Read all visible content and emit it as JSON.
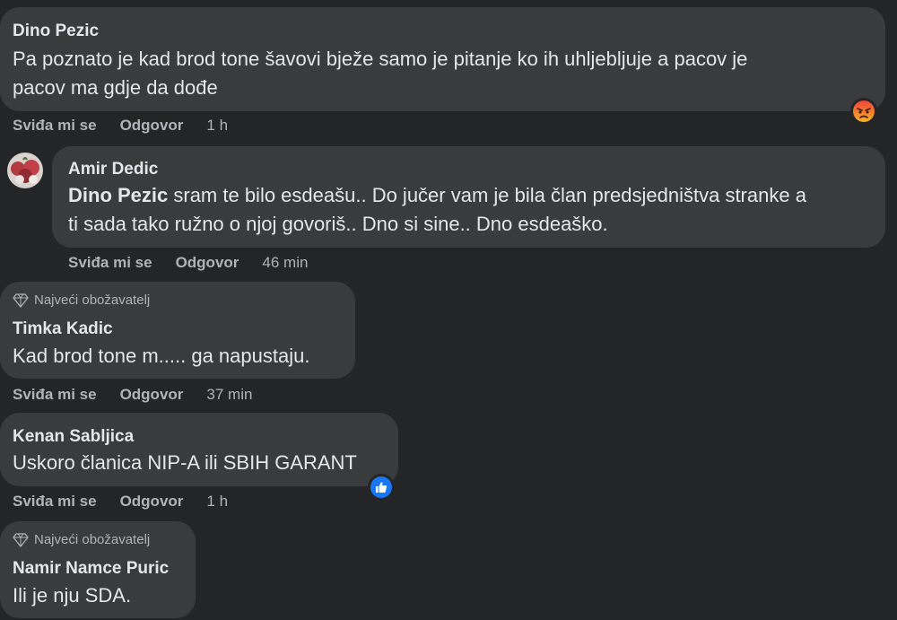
{
  "comments": [
    {
      "author": "Dino Pezic",
      "text_lines": [
        "Pa poznato je kad brod tone šavovi bježe samo je pitanje ko ih uhljebljuje a pacov je",
        "pacov ma gdje da dođe"
      ],
      "like_label": "Sviđa mi se",
      "reply_label": "Odgovor",
      "time": "1 h",
      "reaction": "angry-reaction-icon"
    },
    {
      "author": "Amir Dedic",
      "mention": "Dino Pezic",
      "text_line1_rest": " sram te bilo esdeašu.. Do jučer vam je bila član predsjedništva stranke a",
      "text_line2": "ti sada tako ružno o njoj govoriš.. Dno si sine.. Dno esdeaško.",
      "like_label": "Sviđa mi se",
      "reply_label": "Odgovor",
      "time": "46 min"
    },
    {
      "badge": "Najveći obožavatelj",
      "author": "Timka Kadic",
      "text": "Kad brod tone m..... ga napustaju.",
      "like_label": "Sviđa mi se",
      "reply_label": "Odgovor",
      "time": "37 min"
    },
    {
      "author": "Kenan Sabljica",
      "text": "Uskoro članica NIP-A ili SBIH GARANT",
      "like_label": "Sviđa mi se",
      "reply_label": "Odgovor",
      "time": "1 h",
      "reaction": "like-reaction-icon"
    },
    {
      "badge": "Najveći obožavatelj",
      "author": "Namir Namce Puric",
      "text": "Ili je nju SDA."
    }
  ],
  "colors": {
    "background": "#242526",
    "bubble": "#3a3b3c",
    "text": "#e4e6eb",
    "muted": "#b0b3b8",
    "like_blue": "#1877f2",
    "angry_orange": "#e9710f"
  }
}
